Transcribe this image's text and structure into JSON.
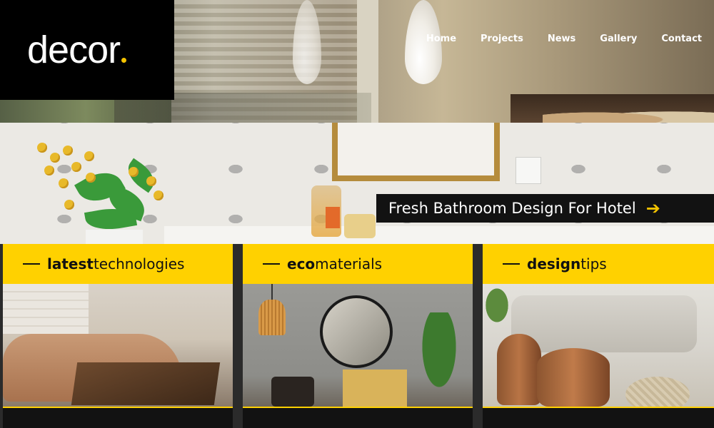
{
  "brand": {
    "logo_text": "decor"
  },
  "nav": {
    "items": [
      "Home",
      "Projects",
      "News",
      "Gallery",
      "Contact"
    ]
  },
  "hero": {
    "caption": "Fresh Bathroom Design For Hotel",
    "arrow_icon": "arrow-right-icon"
  },
  "cards": [
    {
      "bold": "latest",
      "rest": "technologies"
    },
    {
      "bold": "eco",
      "rest": "materials"
    },
    {
      "bold": "design",
      "rest": "tips"
    }
  ],
  "colors": {
    "accent": "#ffd100",
    "dark": "#121212"
  }
}
